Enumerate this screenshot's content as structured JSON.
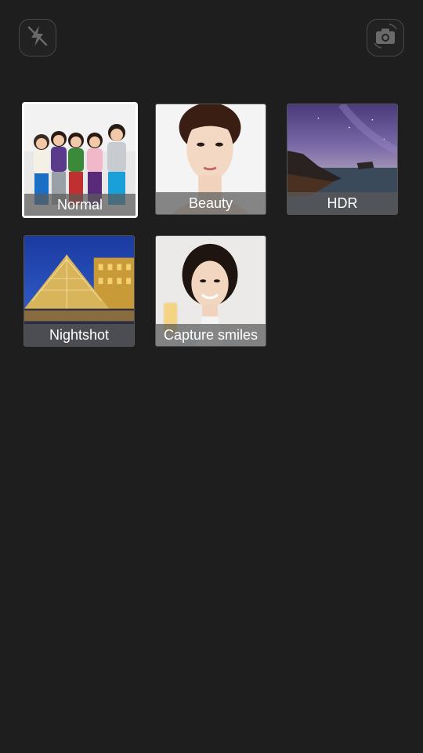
{
  "top_bar": {
    "flash_icon": "flash-off-icon",
    "switch_icon": "camera-switch-icon"
  },
  "modes": [
    {
      "label": "Normal",
      "selected": true,
      "image": "group of children posing"
    },
    {
      "label": "Beauty",
      "selected": false,
      "image": "woman face portrait"
    },
    {
      "label": "HDR",
      "selected": false,
      "image": "coastal night sky"
    },
    {
      "label": "Nightshot",
      "selected": false,
      "image": "Louvre pyramid at night"
    },
    {
      "label": "Capture smiles",
      "selected": false,
      "image": "smiling woman with drink"
    }
  ],
  "colors": {
    "background": "#1e1e1e",
    "selected_border": "#ffffff",
    "caption_bg": "#5a5a5a"
  }
}
